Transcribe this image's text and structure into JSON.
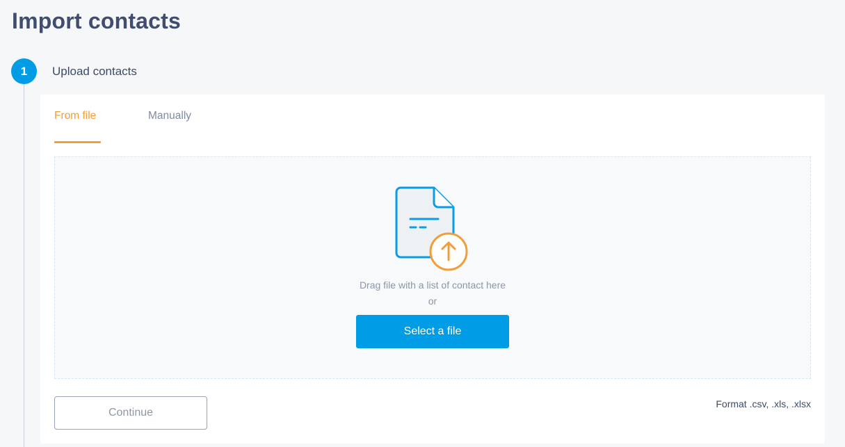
{
  "page": {
    "title": "Import contacts"
  },
  "step": {
    "number": "1",
    "label": "Upload contacts"
  },
  "tabs": [
    {
      "label": "From file",
      "active": true
    },
    {
      "label": "Manually",
      "active": false
    }
  ],
  "dropzone": {
    "icon": "file-upload-icon",
    "drag_text": "Drag file with a list of contact here",
    "or_text": "or",
    "select_button": "Select a file"
  },
  "footer": {
    "continue_button": "Continue",
    "format_text": "Format .csv, .xls, .xlsx"
  },
  "colors": {
    "accent_blue": "#009de6",
    "accent_orange": "#f29d38",
    "title": "#404d6e"
  }
}
